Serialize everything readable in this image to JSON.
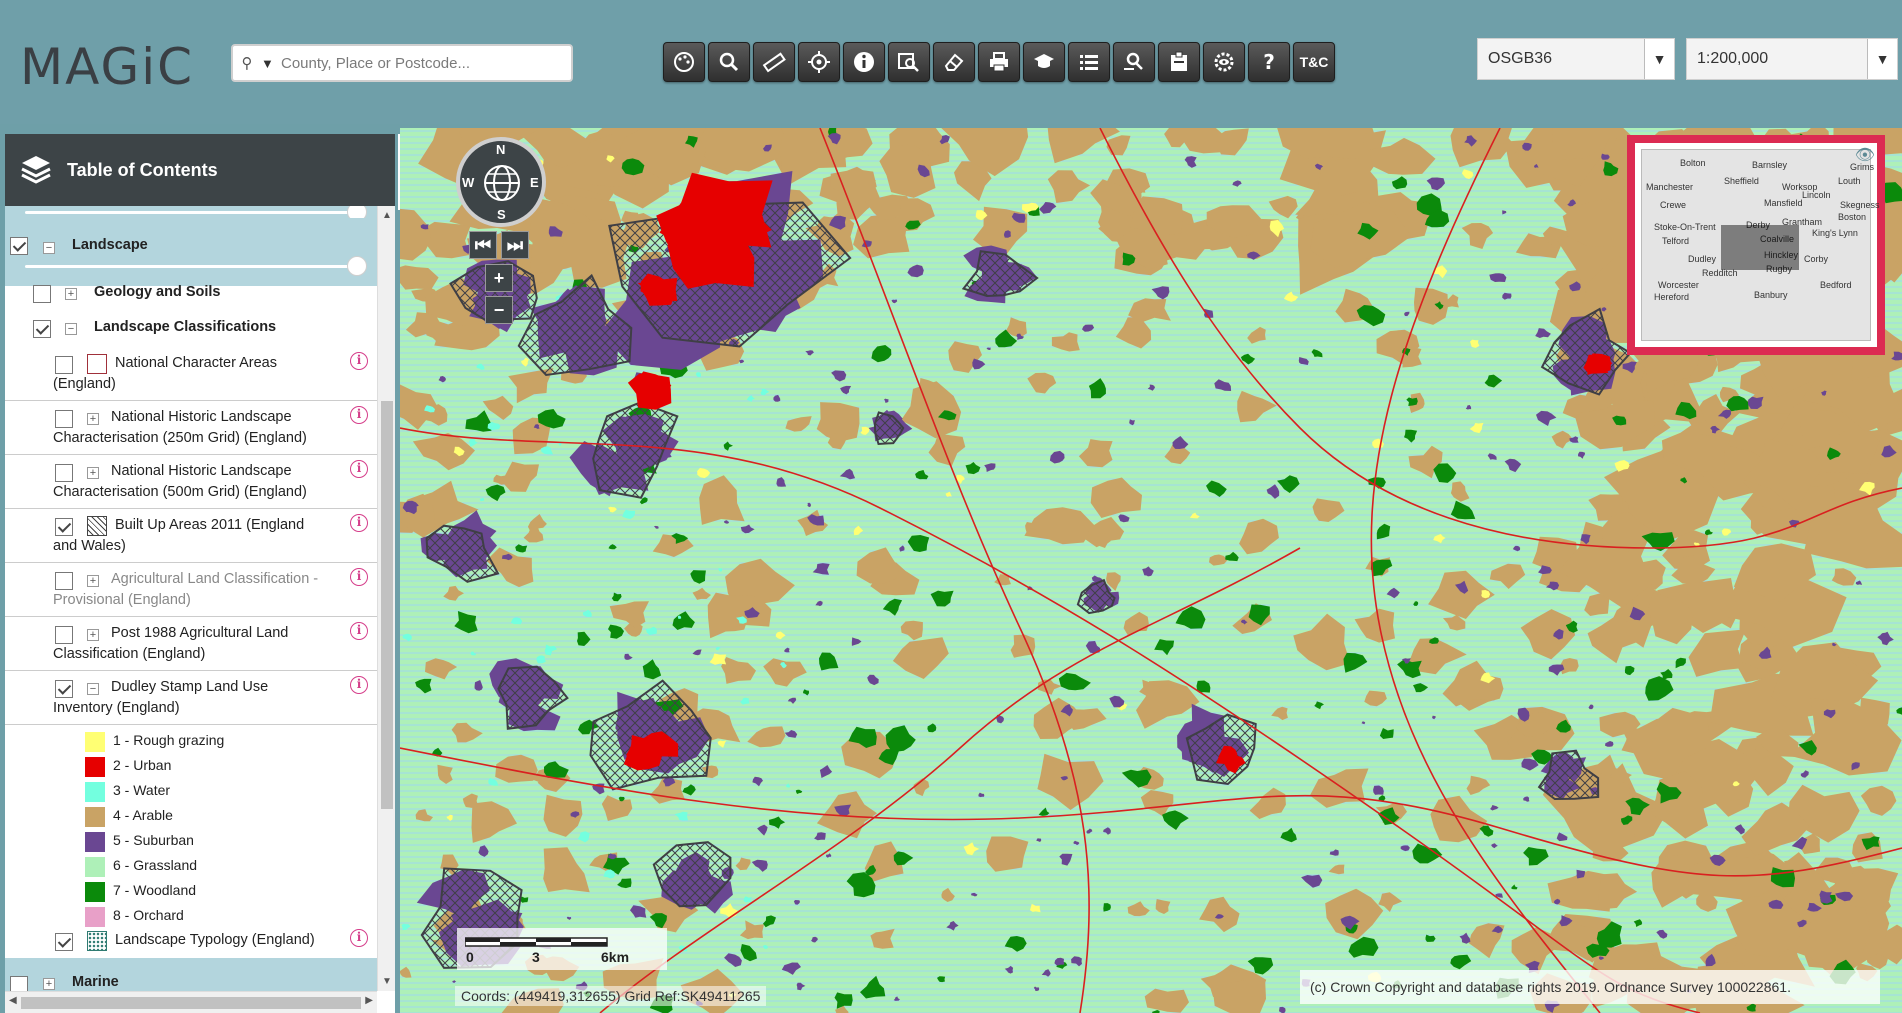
{
  "header": {
    "logo": "MAGiC",
    "search_placeholder": "County, Place or Postcode...",
    "toolbar": [
      {
        "name": "layers-tool-button",
        "icon": "palette-icon"
      },
      {
        "name": "search-tool-button",
        "icon": "magnifier-icon"
      },
      {
        "name": "measure-tool-button",
        "icon": "ruler-icon"
      },
      {
        "name": "locate-tool-button",
        "icon": "target-icon"
      },
      {
        "name": "identify-tool-button",
        "icon": "info-icon"
      },
      {
        "name": "query-tool-button",
        "icon": "zoom-select-icon"
      },
      {
        "name": "erase-tool-button",
        "icon": "eraser-icon"
      },
      {
        "name": "print-tool-button",
        "icon": "printer-icon"
      },
      {
        "name": "help-guide-button",
        "icon": "graduation-cap-icon"
      },
      {
        "name": "list-tool-button",
        "icon": "list-icon"
      },
      {
        "name": "search-results-button",
        "icon": "search-list-icon"
      },
      {
        "name": "bookmark-tool-button",
        "icon": "clipboard-icon"
      },
      {
        "name": "settings-tool-button",
        "icon": "gear-eye-icon"
      },
      {
        "name": "help-button",
        "icon": "question-icon"
      },
      {
        "name": "terms-button",
        "label": "T&C"
      }
    ],
    "projection": "OSGB36",
    "scale": "1:200,000"
  },
  "toc": {
    "title": "Table of Contents",
    "group": "Landscape",
    "items": [
      {
        "label": "Geology and Soils",
        "checked": false,
        "expander": "+"
      },
      {
        "label": "Landscape Classifications",
        "checked": true,
        "expander": "−"
      }
    ],
    "layers": [
      {
        "l1": "National Character Areas",
        "l2": "(England)",
        "checked": false
      },
      {
        "l1": "National Historic Landscape",
        "l2": "Characterisation (250m Grid) (England)",
        "checked": false
      },
      {
        "l1": "National Historic Landscape",
        "l2": "Characterisation (500m Grid) (England)",
        "checked": false
      },
      {
        "l1": "Built Up Areas 2011 (England",
        "l2": "and Wales)",
        "checked": true
      },
      {
        "l1": "Agricultural Land Classification -",
        "l2": "Provisional (England)",
        "checked": false
      },
      {
        "l1": "Post 1988 Agricultural Land",
        "l2": "Classification (England)",
        "checked": false
      },
      {
        "l1": "Dudley Stamp Land Use",
        "l2": "Inventory (England)",
        "checked": true
      }
    ],
    "legend": [
      {
        "label": "1 - Rough grazing",
        "color": "#ffff73"
      },
      {
        "label": "2 - Urban",
        "color": "#e60000"
      },
      {
        "label": "3 - Water",
        "color": "#73ffdf"
      },
      {
        "label": "4 - Arable",
        "color": "#c9a365"
      },
      {
        "label": "5 - Suburban",
        "color": "#6a4792"
      },
      {
        "label": "6 - Grassland",
        "color": "#aef0b8"
      },
      {
        "label": "7 - Woodland",
        "color": "#0b8a0b"
      },
      {
        "label": "8 - Orchard",
        "color": "#e8a0c8"
      }
    ],
    "last_layer": "Landscape Typology (England)",
    "next_group": "Marine"
  },
  "map": {
    "compass": {
      "n": "N",
      "s": "S",
      "e": "E",
      "w": "W"
    },
    "overview_towns": [
      "Bolton",
      "Barnsley",
      "Grims",
      "Manchester",
      "Sheffield",
      "Worksop",
      "Louth",
      "Lincoln",
      "Mansfield",
      "Skegness",
      "Crewe",
      "Derby",
      "Grantham",
      "Boston",
      "Stoke-On-Trent",
      "Coalville",
      "King's Lynn",
      "Telford",
      "Hinckley",
      "Corby",
      "Dudley",
      "Rugby",
      "Redditch",
      "Worcester",
      "Bedford",
      "Hereford",
      "Banbury"
    ],
    "scalebar": {
      "t0": "0",
      "t1": "3",
      "t2": "6km"
    },
    "coords": "Coords: (449419,312655) Grid Ref:SK49411265",
    "copyright": "(c) Crown Copyright and database rights 2019. Ordnance Survey 100022861."
  }
}
